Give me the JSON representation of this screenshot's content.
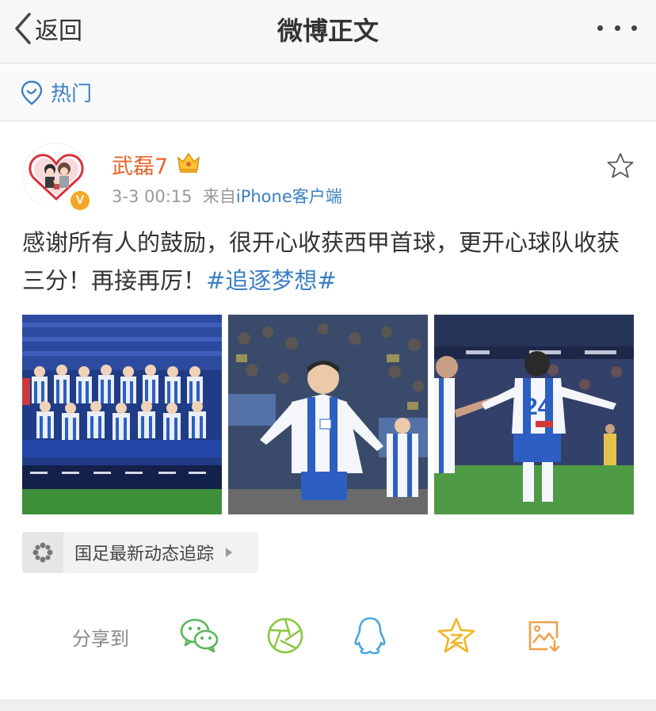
{
  "nav": {
    "back_label": "返回",
    "title": "微博正文"
  },
  "hot": {
    "label": "热门"
  },
  "post": {
    "username": "武磊7",
    "time": "3-3 00:15",
    "source_prefix": "来自",
    "source": "iPhone客户端",
    "text_main": "感谢所有人的鼓励，很开心收获西甲首球，更开心球队收获三分！再接再厉！",
    "hashtag": "#追逐梦想#",
    "photos": [
      {
        "description": "team-photo",
        "jersey_text": ""
      },
      {
        "description": "celebration",
        "jersey_text": ""
      },
      {
        "description": "celebration-back",
        "jersey_text": "24"
      }
    ]
  },
  "topic": {
    "label": "国足最新动态追踪"
  },
  "share": {
    "label": "分享到",
    "targets": [
      "wechat",
      "moments",
      "qq",
      "qzone",
      "save-image"
    ]
  },
  "colors": {
    "accent": "#3b7fc4",
    "username": "#e8652e",
    "star": "#f5a623"
  }
}
